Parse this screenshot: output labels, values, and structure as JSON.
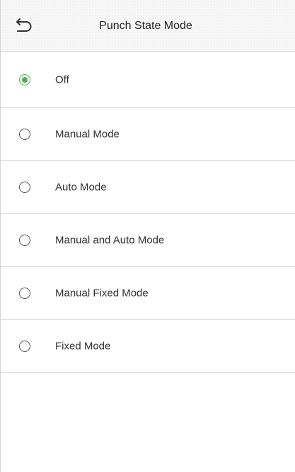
{
  "header": {
    "title": "Punch State Mode",
    "back_icon": "back-arrow-icon"
  },
  "options": [
    {
      "label": "Off",
      "selected": true
    },
    {
      "label": "Manual Mode",
      "selected": false
    },
    {
      "label": "Auto Mode",
      "selected": false
    },
    {
      "label": "Manual and Auto Mode",
      "selected": false
    },
    {
      "label": "Manual Fixed Mode",
      "selected": false
    },
    {
      "label": "Fixed Mode",
      "selected": false
    }
  ],
  "colors": {
    "accent": "#4caf50",
    "divider": "#d6d6d6",
    "text": "#333333"
  }
}
